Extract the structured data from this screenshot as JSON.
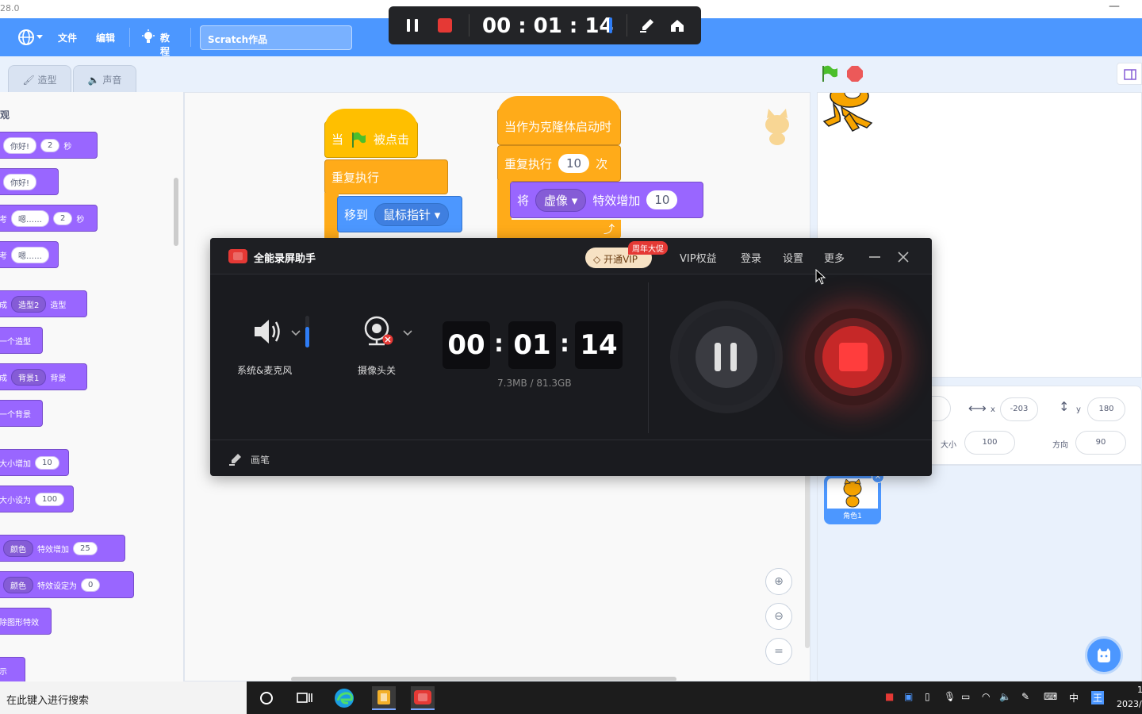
{
  "window": {
    "version": "28.0",
    "minimize": "—"
  },
  "menubar": {
    "file": "文件",
    "edit": "编辑",
    "tutorials": "教程",
    "project_title": "Scratch作品"
  },
  "tabs": {
    "costumes": "造型",
    "sounds": "声音"
  },
  "palette": {
    "category": "外观",
    "blocks": [
      {
        "pre": "说",
        "pill1": "你好!",
        "pill2": "2",
        "post": "秒"
      },
      {
        "pre": "说",
        "pill1": "你好!"
      },
      {
        "pre": "思考",
        "pill1": "嗯……",
        "pill2": "2",
        "post": "秒"
      },
      {
        "pre": "思考",
        "pill1": "嗯……"
      },
      {
        "pre": "换成",
        "dd": "造型2",
        "post": "造型"
      },
      {
        "pre": "下一个造型"
      },
      {
        "pre": "换成",
        "dd": "背景1",
        "post": "背景"
      },
      {
        "pre": "下一个背景"
      },
      {
        "pre": "将大小增加",
        "pill1": "10"
      },
      {
        "pre": "将大小设为",
        "pill1": "100"
      },
      {
        "pre": "将",
        "dd": "颜色",
        "mid": "特效增加",
        "pill1": "25"
      },
      {
        "pre": "将",
        "dd": "颜色",
        "mid": "特效设定为",
        "pill1": "0"
      },
      {
        "pre": "清除图形特效"
      },
      {
        "pre": "显示"
      }
    ]
  },
  "workspace": {
    "script1": {
      "hat_when": "当",
      "hat_clicked": "被点击",
      "forever": "重复执行",
      "goto": "移到",
      "goto_target": "鼠标指针"
    },
    "script2": {
      "hat": "当作为克隆体启动时",
      "repeat": "重复执行",
      "repeat_count": "10",
      "repeat_times": "次",
      "effect_pre": "将",
      "effect_name": "虚像",
      "effect_change": "特效增加",
      "effect_value": "10"
    },
    "zoom_in": "+",
    "zoom_out": "−",
    "zoom_reset": "="
  },
  "sprite_info": {
    "x_label": "x",
    "x_value": "-203",
    "y_label": "y",
    "y_value": "180",
    "size_label": "大小",
    "size_value": "100",
    "direction_label": "方向",
    "direction_value": "90",
    "sprite_name": "角色1"
  },
  "recorder_bar": {
    "time": "00 : 01 : 14"
  },
  "recorder": {
    "app_name": "全能录屏助手",
    "vip_button": "开通VIP",
    "promo_badge": "周年大促",
    "nav": [
      "VIP权益",
      "登录",
      "设置",
      "更多"
    ],
    "audio_label": "系统&麦克风",
    "camera_label": "摄像头关",
    "time_h": "00",
    "time_m": "01",
    "time_s": "14",
    "storage": "7.3MB / 81.3GB",
    "pen": "画笔"
  },
  "taskbar": {
    "search_placeholder": "在此键入进行搜索",
    "ime": "中",
    "clock_time": "1",
    "clock_date": "2023/"
  },
  "colors": {
    "scratch_blue": "#4c97ff",
    "looks_purple": "#9966ff",
    "control_orange": "#ffab19",
    "recorder_red": "#e53935",
    "recorder_bg": "#1a1b1f"
  }
}
